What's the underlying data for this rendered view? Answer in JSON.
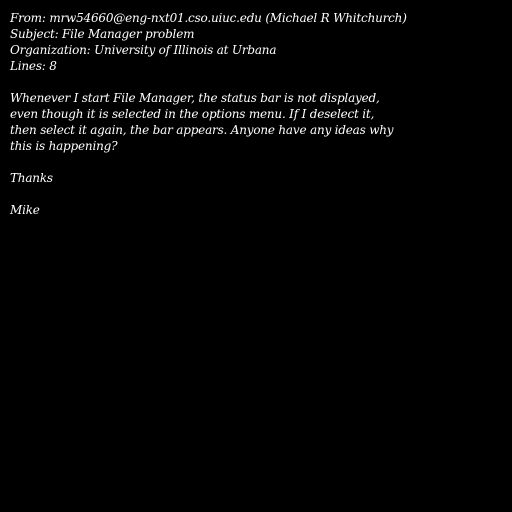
{
  "header": {
    "from": "From: mrw54660@eng-nxt01.cso.uiuc.edu (Michael R Whitchurch)",
    "subject": "Subject: File Manager problem",
    "organization": "Organization: University of Illinois at Urbana",
    "lines": "Lines: 8"
  },
  "body": {
    "paragraph_lines": [
      "Whenever I start File Manager, the status bar is not displayed,",
      "even though it is selected in the options menu. If I deselect it,",
      "then select it again, the bar appears. Anyone have any ideas why",
      "this is happening?"
    ],
    "closing": "Thanks",
    "signature": "Mike"
  }
}
